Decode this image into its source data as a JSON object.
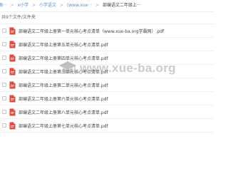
{
  "breadcrumb": {
    "items": [
      "源···",
      "x小学",
      "小学语文",
      "(www.xue···",
      "部编语文二年级上···"
    ]
  },
  "summary": {
    "count_text": "共9个文件/文件夹"
  },
  "files": [
    {
      "name": "部编语文二年级上册第一单元核心考点清单（www.xue-ba.org学霸网）.pdf"
    },
    {
      "name": "部编语文二年级上册第五单元核心考点清单.pdf"
    },
    {
      "name": "部编语文二年级上册第四单元核心考点清单.pdf"
    },
    {
      "name": "部编语文二年级上册第三单元核心考点清单.pdf"
    },
    {
      "name": "部编语文二年级上册第二单元核心考点清单.pdf"
    },
    {
      "name": "部编语文二年级上册第六单元核心考点清单.pdf"
    },
    {
      "name": "部编语文二年级上册第八单元核心考点清单.pdf"
    },
    {
      "name": "部编语文二年级上册第七单元核心考点清单.pdf"
    }
  ],
  "watermark": {
    "text": "www.xue-ba.org",
    "icon": "graduation-cap-icon"
  },
  "colors": {
    "link": "#5b8ec8",
    "pdf_icon": "#e04a3f",
    "separator": "#aaaaaa"
  }
}
